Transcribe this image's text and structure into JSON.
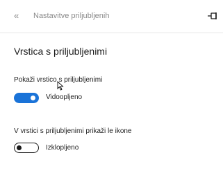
{
  "header": {
    "collapse_icon": "double-chevron-left-icon",
    "title": "Nastavitve priljubljenih",
    "pin_icon": "pin-icon"
  },
  "section": {
    "title": "Vrstica s priljubljenimi"
  },
  "settings": [
    {
      "label": "Pokaži vrstico s priljubljenimi",
      "toggle_on": true,
      "state_text": "Vidoopljeno"
    },
    {
      "label": "V vrstici s priljubljenimi prikaži le ikone",
      "toggle_on": false,
      "state_text": "Izklopljeno"
    }
  ],
  "colors": {
    "accent": "#1a73d8",
    "panel_bg": "#ffffff",
    "muted_text": "#8a8a8a"
  }
}
